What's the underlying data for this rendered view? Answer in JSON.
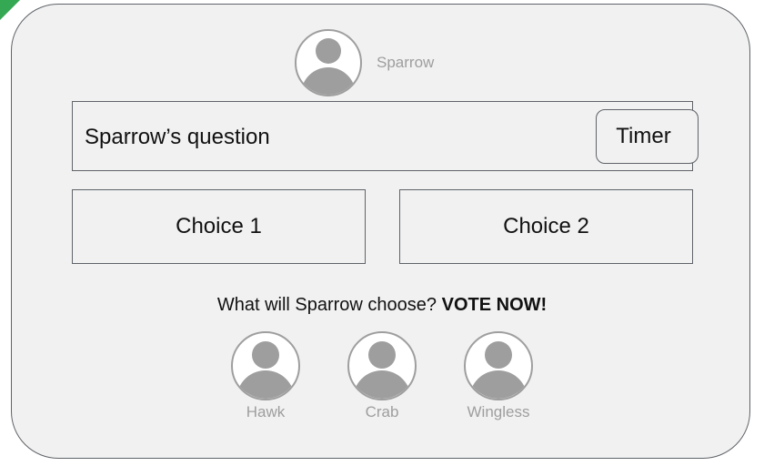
{
  "host": {
    "name": "Sparrow"
  },
  "question": {
    "text": "Sparrow’s question",
    "timer_label": "Timer"
  },
  "choices": [
    {
      "label": "Choice 1"
    },
    {
      "label": "Choice 2"
    }
  ],
  "vote": {
    "prompt": "What will Sparrow choose?",
    "cta": "VOTE NOW!"
  },
  "voters": [
    {
      "name": "Hawk"
    },
    {
      "name": "Crab"
    },
    {
      "name": "Wingless"
    }
  ],
  "colors": {
    "background": "#f1f1f1",
    "border": "#5f6368",
    "avatar": "#9e9e9e",
    "corner_accent": "#34a853"
  },
  "icons": {
    "avatar": "user-avatar-icon"
  }
}
